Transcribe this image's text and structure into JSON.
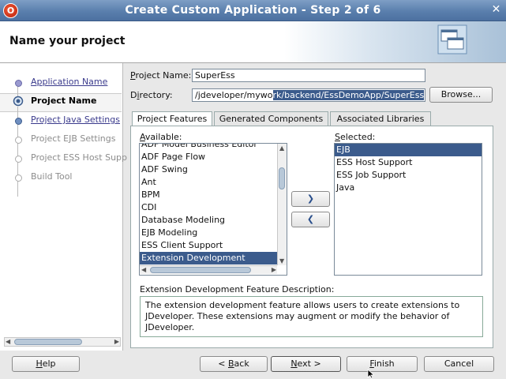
{
  "window": {
    "title": "Create Custom Application - Step 2 of 6",
    "close_glyph": "✕"
  },
  "header": {
    "page_title": "Name your project"
  },
  "nav": {
    "items": [
      {
        "label": "Application Name",
        "state": "link"
      },
      {
        "label": "Project Name",
        "state": "current"
      },
      {
        "label": "Project Java Settings",
        "state": "link"
      },
      {
        "label": "Project EJB Settings",
        "state": "disabled"
      },
      {
        "label": "Project ESS Host Supp",
        "state": "disabled"
      },
      {
        "label": "Build Tool",
        "state": "disabled"
      }
    ]
  },
  "form": {
    "project_name_label": "Project Name:",
    "project_name_value": "SuperEss",
    "directory_label": "Directory:",
    "directory_value_plain": "/jdeveloper/mywo",
    "directory_value_selected": "rk/backend/EssDemoApp/SuperEss",
    "browse_label": "Browse..."
  },
  "tabs": [
    "Project Features",
    "Generated Components",
    "Associated Libraries"
  ],
  "available": {
    "label": "Available:",
    "items": [
      "ADF Model Business Editor",
      "ADF Page Flow",
      "ADF Swing",
      "Ant",
      "BPM",
      "CDI",
      "Database Modeling",
      "EJB Modeling",
      "ESS Client Support",
      "Extension Development"
    ],
    "selected_item": "Extension Development"
  },
  "selected": {
    "label": "Selected:",
    "items": [
      "EJB",
      "ESS Host Support",
      "ESS Job Support",
      "Java"
    ],
    "selected_item": "EJB"
  },
  "shuttle": {
    "add_glyph": "❯",
    "remove_glyph": "❮"
  },
  "description": {
    "label": "Extension Development Feature Description:",
    "text": "The extension development feature allows users to create extensions to JDeveloper. These extensions may augment or modify the behavior of JDeveloper."
  },
  "buttons": {
    "help": "Help",
    "back": "< Back",
    "next": "Next >",
    "finish": "Finish",
    "cancel": "Cancel"
  },
  "colors": {
    "selection": "#3b5b8c",
    "title_bar": "#5a7fad"
  }
}
